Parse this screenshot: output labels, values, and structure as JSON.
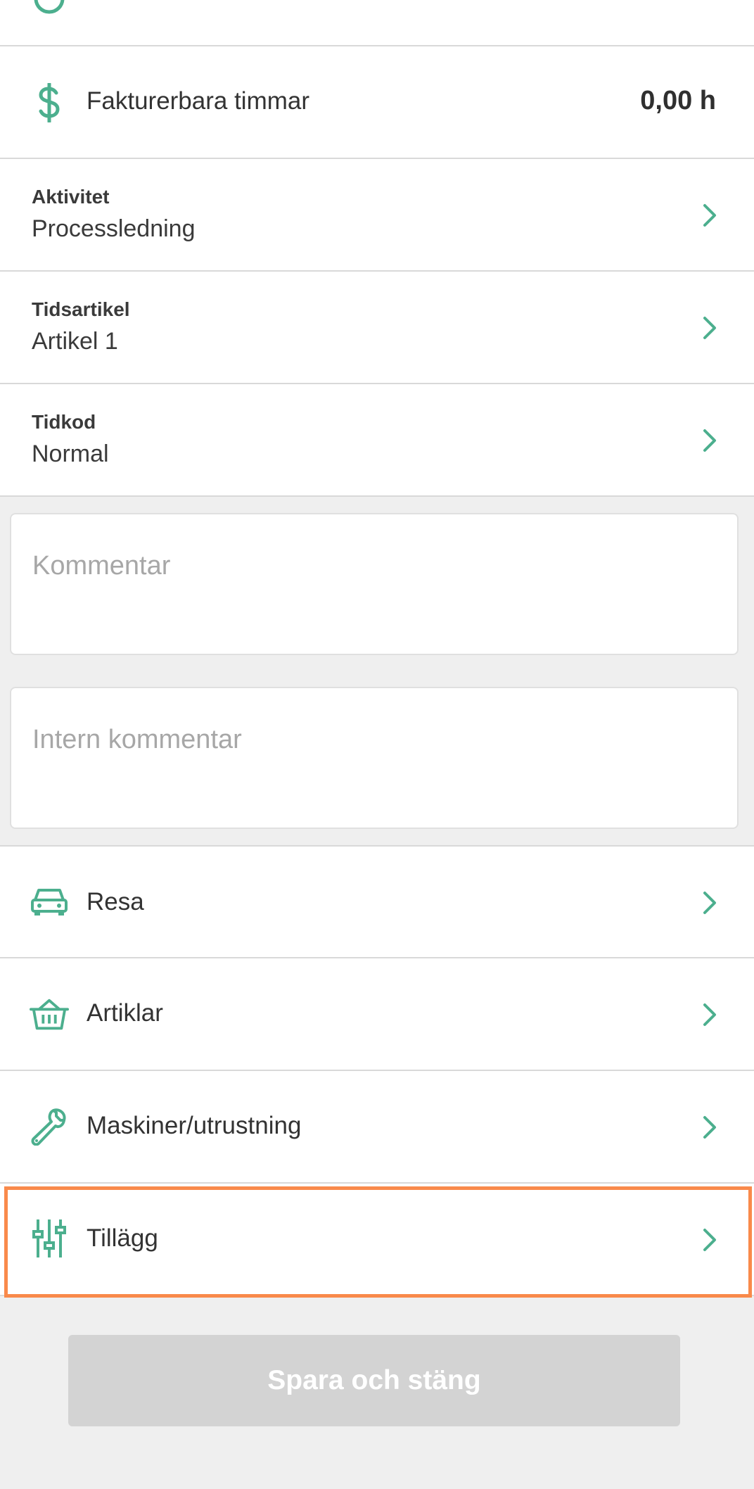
{
  "colors": {
    "accent": "#4caf8e",
    "highlight": "#f98a4b",
    "button_disabled": "#d3d3d3"
  },
  "billable": {
    "label": "Fakturerbara timmar",
    "value": "0,00 h",
    "icon": "dollar-icon"
  },
  "fields": [
    {
      "label": "Aktivitet",
      "value": "Processledning"
    },
    {
      "label": "Tidsartikel",
      "value": "Artikel 1"
    },
    {
      "label": "Tidkod",
      "value": "Normal"
    }
  ],
  "comment": {
    "placeholder": "Kommentar"
  },
  "internal_comment": {
    "placeholder": "Intern kommentar"
  },
  "links": [
    {
      "label": "Resa",
      "icon": "car-icon"
    },
    {
      "label": "Artiklar",
      "icon": "basket-icon"
    },
    {
      "label": "Maskiner/utrustning",
      "icon": "wrench-icon"
    },
    {
      "label": "Tillägg",
      "icon": "sliders-icon"
    }
  ],
  "save_button": {
    "label": "Spara och stäng"
  }
}
